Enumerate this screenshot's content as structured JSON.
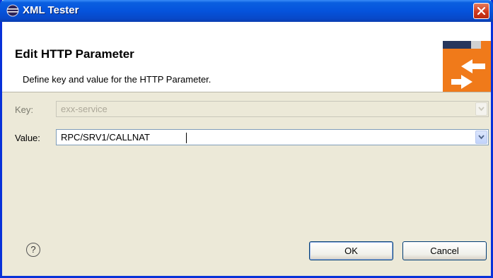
{
  "window": {
    "title": "XML Tester",
    "app_icon": "eclipse-icon",
    "close_icon": "close-icon"
  },
  "header": {
    "title": "Edit HTTP Parameter",
    "description": "Define key and value for the HTTP Parameter.",
    "banner_icon": "exchange-arrows-icon",
    "accent_color": "#f07a1a"
  },
  "form": {
    "key": {
      "label": "Key:",
      "value": "exx-service",
      "enabled": false
    },
    "value": {
      "label": "Value:",
      "value": "RPC/SRV1/CALLNAT",
      "enabled": true
    }
  },
  "footer": {
    "help_icon": "help-icon",
    "help_glyph": "?",
    "ok_label": "OK",
    "cancel_label": "Cancel"
  }
}
